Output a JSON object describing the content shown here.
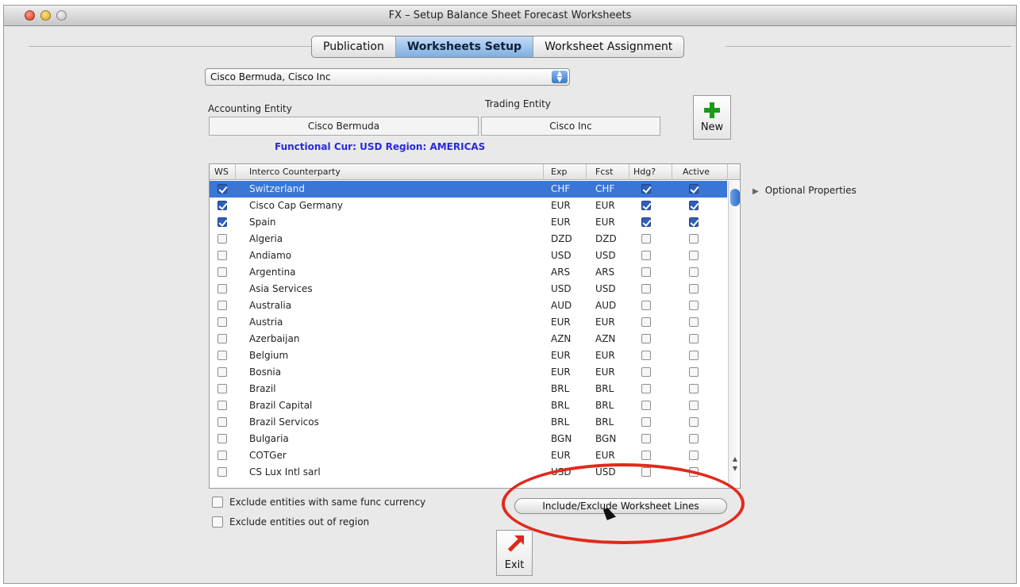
{
  "window": {
    "title": "FX – Setup Balance Sheet Forecast Worksheets"
  },
  "tabs": [
    {
      "label": "Publication",
      "active": false
    },
    {
      "label": "Worksheets Setup",
      "active": true
    },
    {
      "label": "Worksheet Assignment",
      "active": false
    }
  ],
  "entity_selector": {
    "value": "Cisco Bermuda,  Cisco Inc"
  },
  "accounting_entity": {
    "label": "Accounting Entity",
    "value": "Cisco Bermuda"
  },
  "trading_entity": {
    "label": "Trading Entity",
    "value": "Cisco Inc"
  },
  "new_button": {
    "label": "New",
    "icon": "plus-icon"
  },
  "functional_info": "Functional Cur: USD  Region: AMERICAS",
  "table": {
    "headers": {
      "ws": "WS",
      "counterparty": "Interco Counterparty",
      "exp": "Exp",
      "fcst": "Fcst",
      "hdg": "Hdg?",
      "active": "Active"
    },
    "rows": [
      {
        "name": "Switzerland",
        "exp": "CHF",
        "fcst": "CHF",
        "ws": true,
        "hdg": true,
        "active": true,
        "selected": true
      },
      {
        "name": "Cisco Cap Germany",
        "exp": "EUR",
        "fcst": "EUR",
        "ws": true,
        "hdg": true,
        "active": true,
        "selected": false
      },
      {
        "name": "Spain",
        "exp": "EUR",
        "fcst": "EUR",
        "ws": true,
        "hdg": true,
        "active": true,
        "selected": false
      },
      {
        "name": "Algeria",
        "exp": "DZD",
        "fcst": "DZD",
        "ws": false,
        "hdg": false,
        "active": false,
        "selected": false
      },
      {
        "name": "Andiamo",
        "exp": "USD",
        "fcst": "USD",
        "ws": false,
        "hdg": false,
        "active": false,
        "selected": false
      },
      {
        "name": "Argentina",
        "exp": "ARS",
        "fcst": "ARS",
        "ws": false,
        "hdg": false,
        "active": false,
        "selected": false
      },
      {
        "name": "Asia Services",
        "exp": "USD",
        "fcst": "USD",
        "ws": false,
        "hdg": false,
        "active": false,
        "selected": false
      },
      {
        "name": "Australia",
        "exp": "AUD",
        "fcst": "AUD",
        "ws": false,
        "hdg": false,
        "active": false,
        "selected": false
      },
      {
        "name": "Austria",
        "exp": "EUR",
        "fcst": "EUR",
        "ws": false,
        "hdg": false,
        "active": false,
        "selected": false
      },
      {
        "name": "Azerbaijan",
        "exp": "AZN",
        "fcst": "AZN",
        "ws": false,
        "hdg": false,
        "active": false,
        "selected": false
      },
      {
        "name": "Belgium",
        "exp": "EUR",
        "fcst": "EUR",
        "ws": false,
        "hdg": false,
        "active": false,
        "selected": false
      },
      {
        "name": "Bosnia",
        "exp": "EUR",
        "fcst": "EUR",
        "ws": false,
        "hdg": false,
        "active": false,
        "selected": false
      },
      {
        "name": "Brazil",
        "exp": "BRL",
        "fcst": "BRL",
        "ws": false,
        "hdg": false,
        "active": false,
        "selected": false
      },
      {
        "name": "Brazil Capital",
        "exp": "BRL",
        "fcst": "BRL",
        "ws": false,
        "hdg": false,
        "active": false,
        "selected": false
      },
      {
        "name": "Brazil Servicos",
        "exp": "BRL",
        "fcst": "BRL",
        "ws": false,
        "hdg": false,
        "active": false,
        "selected": false
      },
      {
        "name": "Bulgaria",
        "exp": "BGN",
        "fcst": "BGN",
        "ws": false,
        "hdg": false,
        "active": false,
        "selected": false
      },
      {
        "name": "COTGer",
        "exp": "EUR",
        "fcst": "EUR",
        "ws": false,
        "hdg": false,
        "active": false,
        "selected": false
      },
      {
        "name": "CS Lux Intl sarl",
        "exp": "USD",
        "fcst": "USD",
        "ws": false,
        "hdg": false,
        "active": false,
        "selected": false
      }
    ]
  },
  "optional_properties": "Optional Properties",
  "options": {
    "exclude_same_currency": {
      "label": "Exclude entities with same func currency",
      "checked": false
    },
    "exclude_out_of_region": {
      "label": "Exclude entities out of region",
      "checked": false
    }
  },
  "include_exclude_button": "Include/Exclude Worksheet Lines",
  "exit_button": {
    "label": "Exit",
    "icon": "exit-arrow-icon"
  },
  "colors": {
    "selection": "#3a76d6",
    "highlight_ellipse": "#e02a1c",
    "info_text": "#2a2ad8",
    "new_icon": "#1c9a1c"
  }
}
